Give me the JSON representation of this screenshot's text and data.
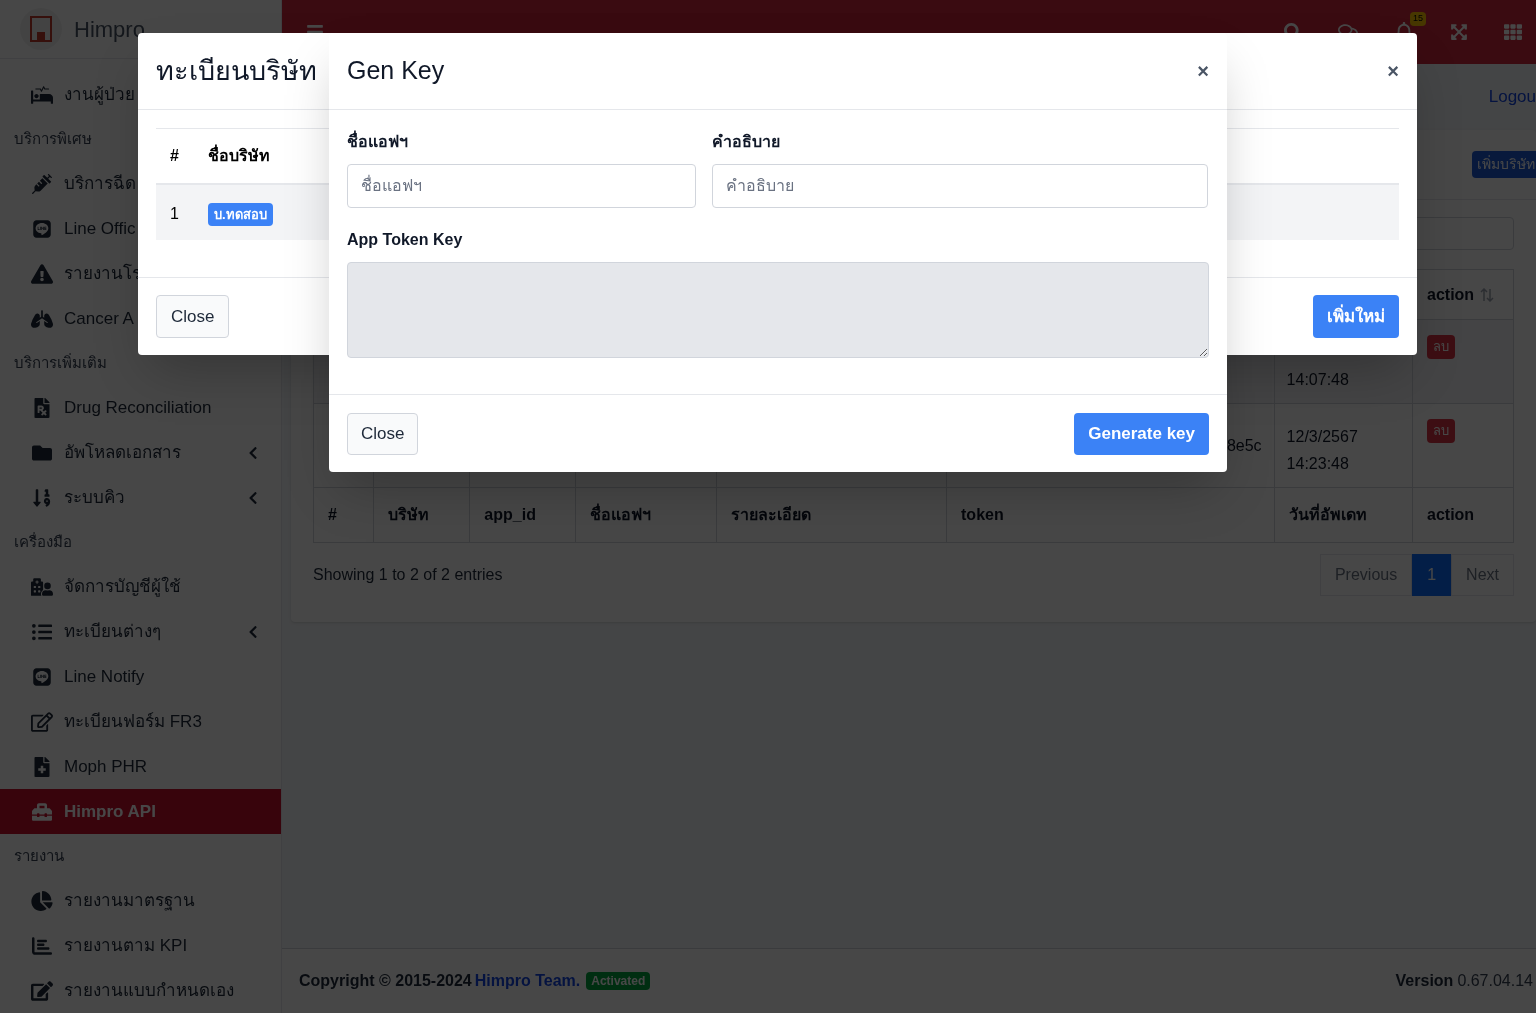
{
  "sidebar": {
    "brand": "Himpro",
    "sections": [
      {
        "items": [
          {
            "label": "งานผู้ป่วย",
            "selected": false
          }
        ]
      },
      {
        "heading": "บริการพิเศษ",
        "items": [
          {
            "label": "บริการฉีด",
            "selected": false
          },
          {
            "label": "Line Offic",
            "selected": false
          },
          {
            "label": "รายงานโร",
            "selected": false
          },
          {
            "label": "Cancer A",
            "selected": false
          }
        ]
      },
      {
        "heading": "บริการเพิ่มเติม",
        "items": [
          {
            "label": "Drug Reconciliation",
            "submenu": false,
            "selected": false
          },
          {
            "label": "อัพโหลดเอกสาร",
            "submenu": true,
            "selected": false
          },
          {
            "label": "ระบบคิว",
            "submenu": true,
            "selected": false
          }
        ]
      },
      {
        "heading": "เครื่องมือ",
        "items": [
          {
            "label": "จัดการบัญชีผู้ใช้",
            "submenu": false,
            "selected": false
          },
          {
            "label": "ทะเบียนต่างๆ",
            "submenu": true,
            "selected": false
          },
          {
            "label": "Line Notify",
            "submenu": false,
            "selected": false
          },
          {
            "label": "ทะเบียนฟอร์ม FR3",
            "submenu": false,
            "selected": false
          },
          {
            "label": "Moph PHR",
            "submenu": false,
            "selected": false
          },
          {
            "label": "Himpro API",
            "submenu": false,
            "selected": true
          }
        ]
      },
      {
        "heading": "รายงาน",
        "items": [
          {
            "label": "รายงานมาตรฐาน",
            "submenu": false,
            "selected": false
          },
          {
            "label": "รายงานตาม KPI",
            "submenu": false,
            "selected": false
          },
          {
            "label": "รายงานแบบกำหนดเอง",
            "submenu": false,
            "selected": false
          }
        ]
      }
    ]
  },
  "navbar": {
    "notification_count": "15"
  },
  "page": {
    "logout": "Logou",
    "add_company_button": "เพิ่มบริษัท",
    "table": {
      "header_action": "action",
      "footer_columns": [
        "#",
        "บริษัท",
        "app_id",
        "ชื่อแอฟฯ",
        "รายละเอียด",
        "token",
        "วันที่อัพเดท",
        "action"
      ],
      "rows": [
        {
          "token": "",
          "date": "",
          "time": "14:07:48",
          "delete": "ลบ"
        },
        {
          "token": "8e5c",
          "date": "12/3/2567",
          "time": "14:23:48",
          "delete": "ลบ"
        }
      ]
    },
    "info": "Showing 1 to 2 of 2 entries",
    "pagination": [
      {
        "label": "Previous",
        "selected": false
      },
      {
        "label": "1",
        "selected": true
      },
      {
        "label": "Next",
        "selected": false
      }
    ]
  },
  "footer": {
    "copyright": "Copyright © 2015-2024",
    "team": "Himpro Team.",
    "status": "Activated",
    "version_label": "Version",
    "version": "0.67.04.14"
  },
  "company_modal": {
    "title": "ทะเบียนบริษัท",
    "close_icon": "×",
    "columns": [
      "#",
      "ชื่อบริษัท"
    ],
    "rows": [
      {
        "number": "1",
        "company": "บ.ทดสอบ"
      }
    ],
    "close_button": "Close",
    "add_button": "เพิ่มใหม่"
  },
  "genkey_modal": {
    "title": "Gen Key",
    "close_icon": "×",
    "fields": [
      {
        "label": "ชื่อแอฟฯ",
        "placeholder": "ชื่อแอฟฯ"
      },
      {
        "label": "คำอธิบาย",
        "placeholder": "คำอธิบาย"
      }
    ],
    "token_label": "App Token Key",
    "close_button": "Close",
    "generate_button": "Generate key"
  }
}
